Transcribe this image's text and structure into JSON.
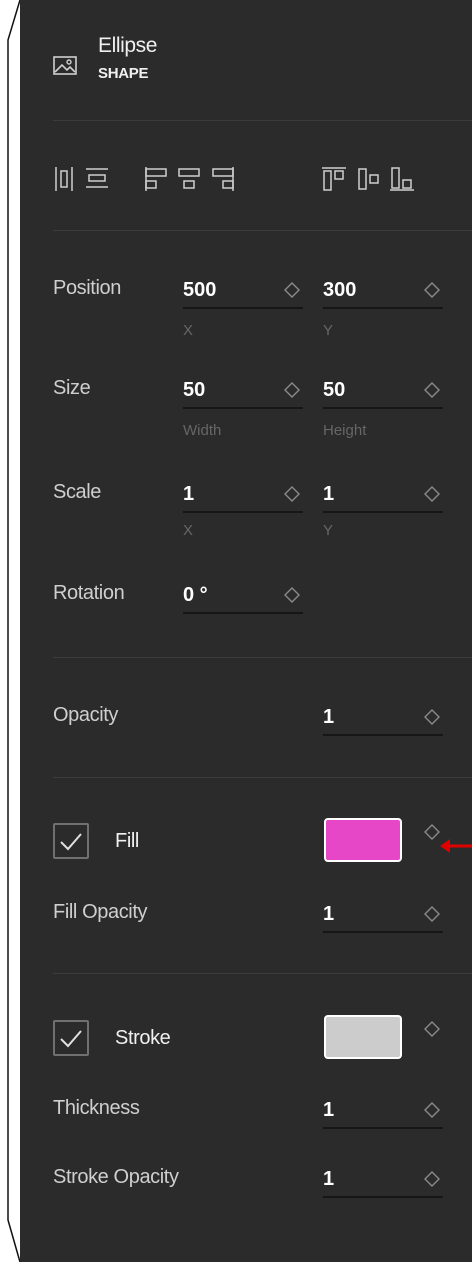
{
  "header": {
    "title": "Ellipse",
    "subtitle": "SHAPE",
    "icon": "image-icon"
  },
  "align_toolbar": {
    "icons": [
      "align-left-edges-icon",
      "align-top-edges-icon",
      "align-left-icon",
      "align-center-horizontal-icon",
      "align-right-icon",
      "align-top-icon",
      "align-middle-icon",
      "align-bottom-icon"
    ]
  },
  "transform": {
    "position": {
      "label": "Position",
      "x": "500",
      "y": "300",
      "x_sub": "X",
      "y_sub": "Y"
    },
    "size": {
      "label": "Size",
      "width": "50",
      "height": "50",
      "width_sub": "Width",
      "height_sub": "Height"
    },
    "scale": {
      "label": "Scale",
      "x": "1",
      "y": "1",
      "x_sub": "X",
      "y_sub": "Y"
    },
    "rotation": {
      "label": "Rotation",
      "value": "0 °"
    }
  },
  "opacity": {
    "label": "Opacity",
    "value": "1"
  },
  "fill": {
    "enabled": true,
    "label": "Fill",
    "color": "#e647c7",
    "opacity_label": "Fill Opacity",
    "opacity": "1"
  },
  "stroke": {
    "enabled": true,
    "label": "Stroke",
    "color": "#cccccc",
    "thickness_label": "Thickness",
    "thickness": "1",
    "opacity_label": "Stroke Opacity",
    "opacity": "1"
  },
  "colors": {
    "panel_bg": "#2b2b2b",
    "divider": "#3c3c3c",
    "accent_arrow": "#e00000"
  }
}
